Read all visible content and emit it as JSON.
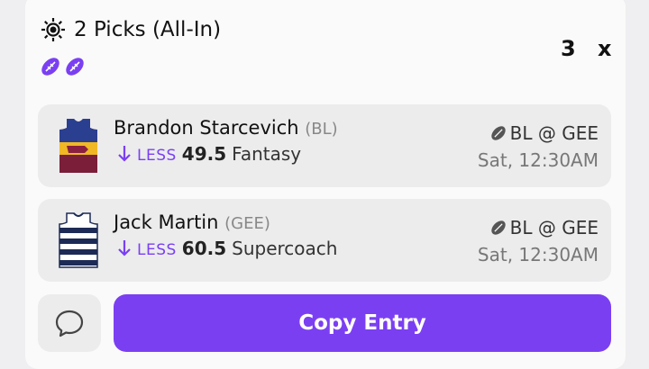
{
  "header": {
    "title": "2 Picks (All-In)",
    "multiplier": "3",
    "close_label": "x"
  },
  "picks": [
    {
      "player": "Brandon Starcevich",
      "team": "(BL)",
      "direction": "LESS",
      "line": "49.5",
      "stat": "Fantasy",
      "matchup": "BL @ GEE",
      "time": "Sat, 12:30AM",
      "jersey": "brisbane-lions-jersey"
    },
    {
      "player": "Jack Martin",
      "team": "(GEE)",
      "direction": "LESS",
      "line": "60.5",
      "stat": "Supercoach",
      "matchup": "BL @ GEE",
      "time": "Sat, 12:30AM",
      "jersey": "geelong-jersey"
    }
  ],
  "footer": {
    "copy_label": "Copy Entry"
  },
  "colors": {
    "accent": "#7b3ff2",
    "card": "#ececed"
  }
}
